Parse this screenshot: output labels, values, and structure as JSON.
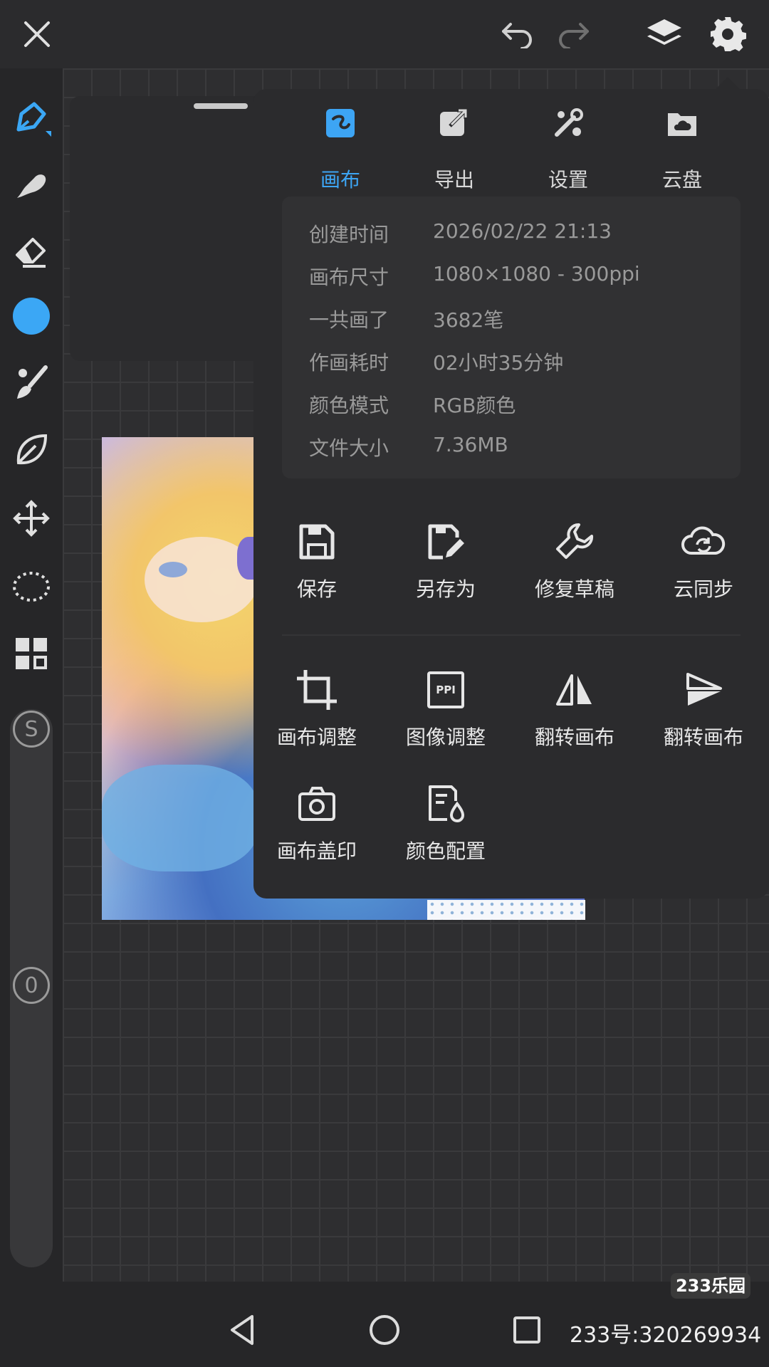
{
  "topbar": {
    "close_icon": "close-icon",
    "undo_icon": "undo-icon",
    "redo_icon": "redo-icon",
    "layers_icon": "layers-icon",
    "settings_icon": "gear-icon"
  },
  "toolbar": {
    "tools": [
      "pen-tool-icon",
      "smudge-icon",
      "eraser-icon",
      "color-swatch",
      "brush-icon",
      "leaf-shape-icon",
      "move-icon",
      "lasso-select-icon",
      "grid-layout-icon"
    ],
    "active_color": "#3ba7f5",
    "size_badge": "S",
    "opacity_badge": "0"
  },
  "menu": {
    "tabs": [
      {
        "label": "画布",
        "icon": "canvas-icon",
        "active": true
      },
      {
        "label": "导出",
        "icon": "export-icon",
        "active": false
      },
      {
        "label": "设置",
        "icon": "settings-tools-icon",
        "active": false
      },
      {
        "label": "云盘",
        "icon": "cloud-drive-icon",
        "active": false
      }
    ],
    "info": [
      {
        "key": "创建时间",
        "value": "2026/02/22 21:13"
      },
      {
        "key": "画布尺寸",
        "value": "1080×1080 - 300ppi"
      },
      {
        "key": "一共画了",
        "value": "3682笔"
      },
      {
        "key": "作画耗时",
        "value": "02小时35分钟"
      },
      {
        "key": "颜色模式",
        "value": "RGB颜色"
      },
      {
        "key": "文件大小",
        "value": "7.36MB"
      }
    ],
    "actions_row1": [
      {
        "label": "保存",
        "icon": "save-icon"
      },
      {
        "label": "另存为",
        "icon": "save-as-icon"
      },
      {
        "label": "修复草稿",
        "icon": "wrench-icon"
      },
      {
        "label": "云同步",
        "icon": "cloud-sync-icon"
      }
    ],
    "actions_row2": [
      {
        "label": "画布调整",
        "icon": "crop-icon"
      },
      {
        "label": "图像调整",
        "icon": "ppi-icon"
      },
      {
        "label": "翻转画布",
        "icon": "flip-horizontal-icon"
      },
      {
        "label": "翻转画布",
        "icon": "flip-vertical-icon"
      }
    ],
    "actions_row3": [
      {
        "label": "画布盖印",
        "icon": "camera-icon"
      },
      {
        "label": "颜色配置",
        "icon": "color-profile-icon"
      }
    ],
    "ppi_icon_text": "PPI"
  },
  "navbar": {
    "back_icon": "back-icon",
    "home_icon": "home-icon",
    "recents_icon": "recents-icon"
  },
  "watermark": {
    "logo": "233乐园",
    "text": "233号:320269934"
  }
}
